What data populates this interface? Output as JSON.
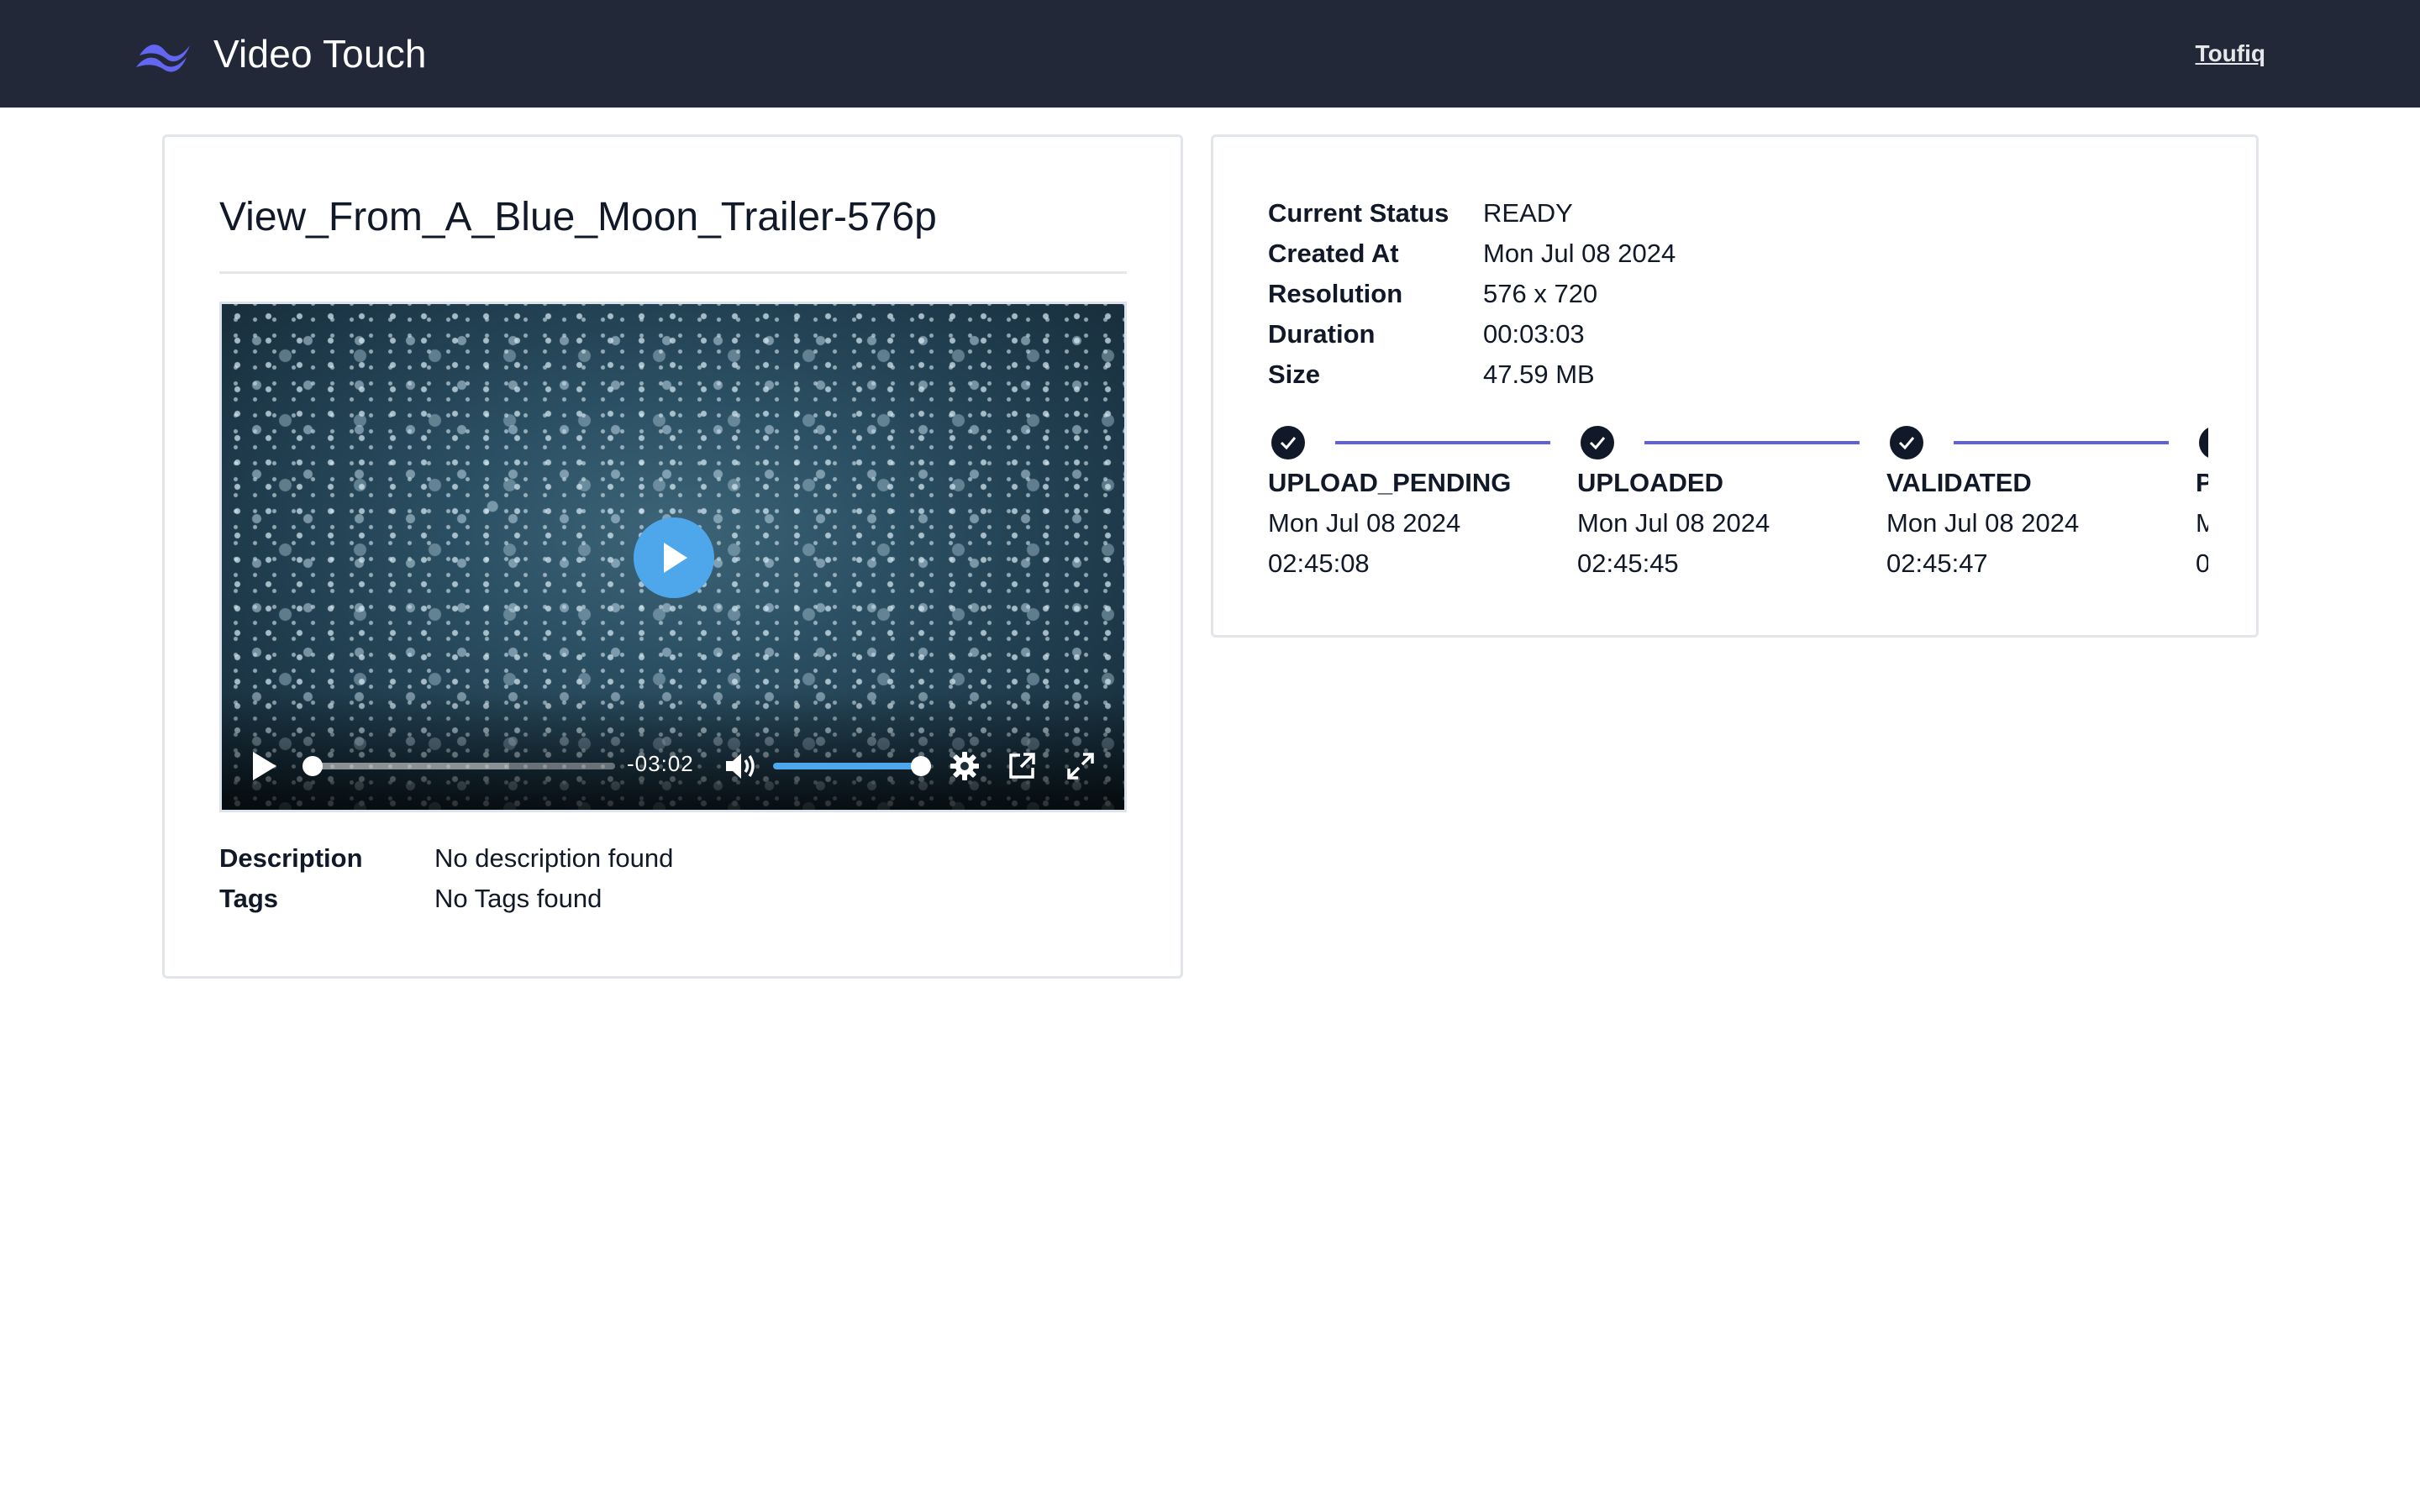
{
  "app": {
    "brand_name": "Video Touch",
    "user_name": "Toufiq",
    "colors": {
      "navbar": "#222838",
      "logo": "#6366f1",
      "accent_line": "#6060d8",
      "player_accent": "#4ea7ea"
    }
  },
  "video": {
    "title": "View_From_A_Blue_Moon_Trailer-576p",
    "player": {
      "remaining_time": "-03:02",
      "progress_fraction": 0.0,
      "volume_fraction": 1.0,
      "icons": [
        "play-icon",
        "volume-icon",
        "settings-gear-icon",
        "pip-icon",
        "fullscreen-icon"
      ]
    },
    "meta": {
      "description_label": "Description",
      "description_value": "No description found",
      "tags_label": "Tags",
      "tags_value": "No Tags found"
    }
  },
  "details": {
    "status_label": "Current Status",
    "status_value": "READY",
    "created_label": "Created At",
    "created_value": "Mon Jul 08 2024",
    "resolution_label": "Resolution",
    "resolution_value": "576 x 720",
    "duration_label": "Duration",
    "duration_value": "00:03:03",
    "size_label": "Size",
    "size_value": "47.59 MB"
  },
  "timeline": [
    {
      "label": "UPLOAD_PENDING",
      "date": "Mon Jul 08 2024",
      "time": "02:45:08"
    },
    {
      "label": "UPLOADED",
      "date": "Mon Jul 08 2024",
      "time": "02:45:45"
    },
    {
      "label": "VALIDATED",
      "date": "Mon Jul 08 2024",
      "time": "02:45:47"
    },
    {
      "label": "P",
      "date": "M",
      "time": "0"
    }
  ]
}
